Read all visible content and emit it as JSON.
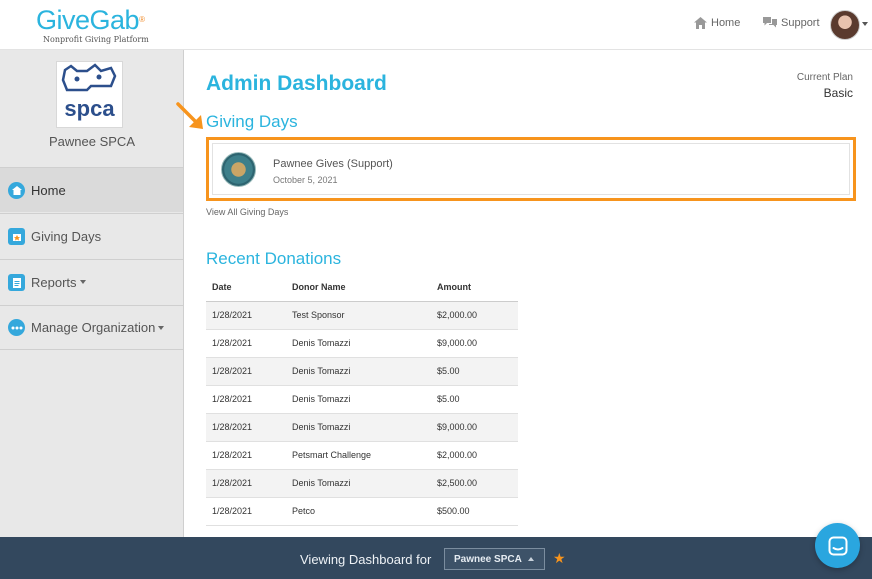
{
  "brand": {
    "name": "GiveGab",
    "tagline": "Nonprofit Giving Platform",
    "accent": "#2bb4de",
    "highlight": "#f7941d"
  },
  "topnav": {
    "home_label": "Home",
    "support_label": "Support"
  },
  "sidebar": {
    "org_name": "Pawnee SPCA",
    "org_logo_text": "spca",
    "items": [
      {
        "label": "Home",
        "icon": "home-icon",
        "active": true
      },
      {
        "label": "Giving Days",
        "icon": "gift-icon",
        "active": false
      },
      {
        "label": "Reports",
        "icon": "clipboard-icon",
        "active": false,
        "dropdown": true
      },
      {
        "label": "Manage Organization",
        "icon": "ellipsis-icon",
        "active": false,
        "dropdown": true
      }
    ]
  },
  "main": {
    "title": "Admin Dashboard",
    "plan": {
      "label": "Current Plan",
      "value": "Basic"
    },
    "giving_days": {
      "title": "Giving Days",
      "event_name": "Pawnee Gives (Support)",
      "event_date": "October 5, 2021",
      "view_all": "View All Giving Days"
    },
    "recent_donations": {
      "title": "Recent Donations",
      "columns": [
        "Date",
        "Donor Name",
        "Amount"
      ],
      "rows": [
        [
          "1/28/2021",
          "Test Sponsor",
          "$2,000.00"
        ],
        [
          "1/28/2021",
          "Denis Tomazzi",
          "$9,000.00"
        ],
        [
          "1/28/2021",
          "Denis Tomazzi",
          "$5.00"
        ],
        [
          "1/28/2021",
          "Denis Tomazzi",
          "$5.00"
        ],
        [
          "1/28/2021",
          "Denis Tomazzi",
          "$9,000.00"
        ],
        [
          "1/28/2021",
          "Petsmart Challenge",
          "$2,000.00"
        ],
        [
          "1/28/2021",
          "Denis Tomazzi",
          "$2,500.00"
        ],
        [
          "1/28/2021",
          "Petco",
          "$500.00"
        ]
      ]
    }
  },
  "bottombar": {
    "viewing_label": "Viewing Dashboard for",
    "selected_org": "Pawnee SPCA"
  }
}
